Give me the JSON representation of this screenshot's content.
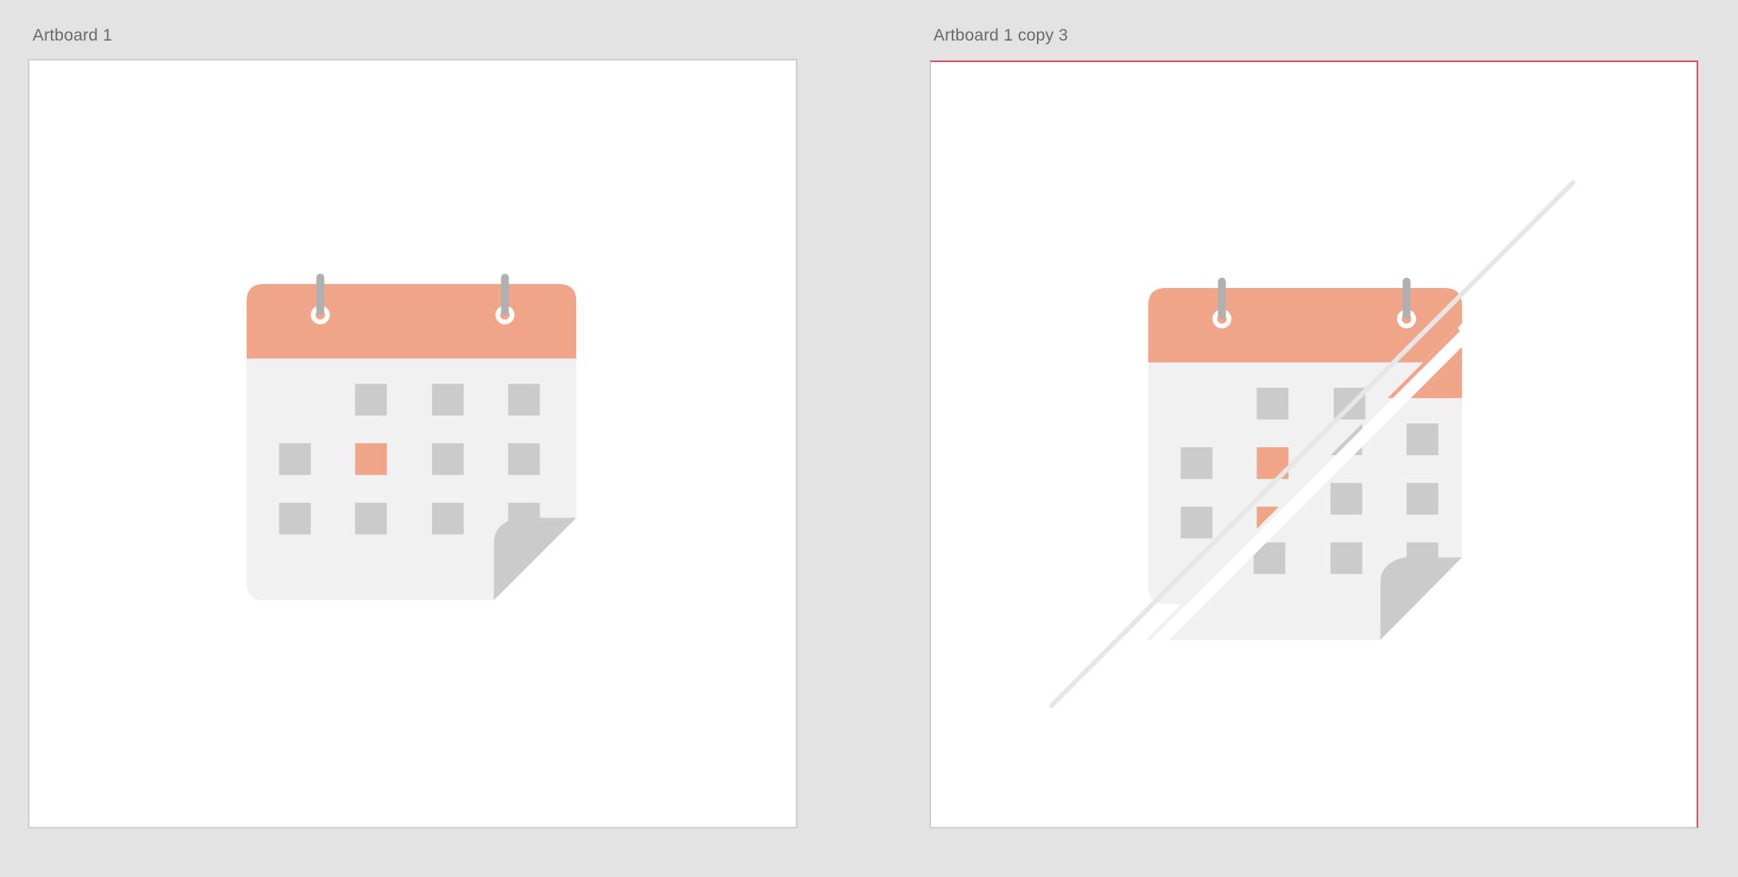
{
  "artboards": [
    {
      "label": "Artboard 1",
      "selected": false
    },
    {
      "label": "Artboard 1 copy 3",
      "selected": true
    }
  ],
  "icons": {
    "calendar": "calendar-icon",
    "calendar_off": "calendar-off-icon"
  },
  "colors": {
    "canvas": "#e3e3e3",
    "artboard": "#ffffff",
    "header": "#f0a588",
    "body": "#f1f1f1",
    "cell": "#cbcbcb",
    "highlight_cell": "#f0a588",
    "ring": "#b0b0b0",
    "page_curl": "#cbcbcb",
    "slash": "#e6e6e6",
    "selection_border": "#e84a5f"
  }
}
